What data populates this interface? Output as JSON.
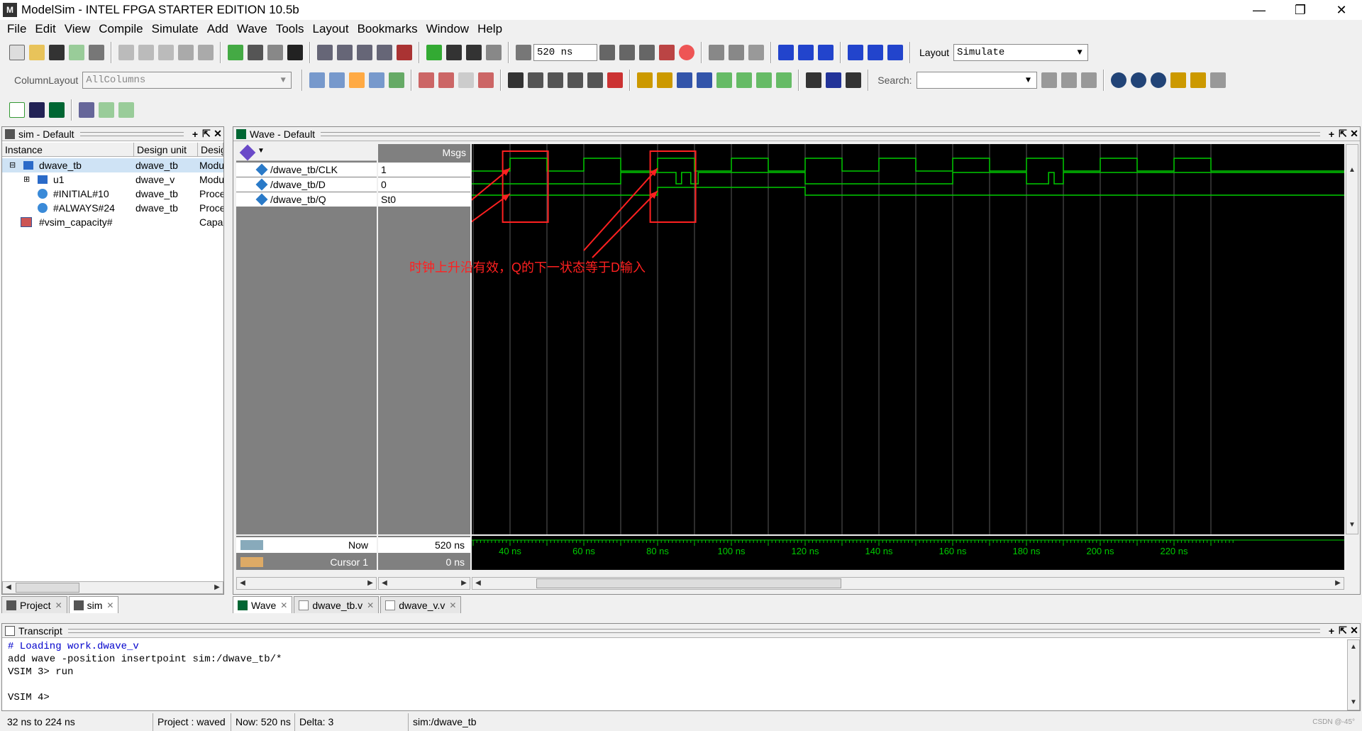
{
  "window": {
    "title": "ModelSim - INTEL FPGA STARTER EDITION 10.5b",
    "app_icon": "M"
  },
  "menu": [
    "File",
    "Edit",
    "View",
    "Compile",
    "Simulate",
    "Add",
    "Wave",
    "Tools",
    "Layout",
    "Bookmarks",
    "Window",
    "Help"
  ],
  "toolbar": {
    "run_length": "520 ns",
    "layout_label": "Layout",
    "layout_value": "Simulate",
    "column_layout_label": "ColumnLayout",
    "column_layout_value": "AllColumns",
    "search_label": "Search:",
    "search_value": ""
  },
  "sim_panel": {
    "title": "sim - Default",
    "columns": [
      "Instance",
      "Design unit",
      "Design"
    ],
    "rows": [
      {
        "instance": "dwave_tb",
        "unit": "dwave_tb",
        "design": "Modul"
      },
      {
        "instance": "u1",
        "unit": "dwave_v",
        "design": "Modul"
      },
      {
        "instance": "#INITIAL#10",
        "unit": "dwave_tb",
        "design": "Proce"
      },
      {
        "instance": "#ALWAYS#24",
        "unit": "dwave_tb",
        "design": "Proce"
      },
      {
        "instance": "#vsim_capacity#",
        "unit": "",
        "design": "Capac"
      }
    ],
    "tabs": [
      "Project",
      "sim"
    ]
  },
  "wave_panel": {
    "title": "Wave - Default",
    "msgs_header": "Msgs",
    "signals": [
      {
        "name": "/dwave_tb/CLK",
        "value": "1"
      },
      {
        "name": "/dwave_tb/D",
        "value": "0"
      },
      {
        "name": "/dwave_tb/Q",
        "value": "St0"
      }
    ],
    "now_label": "Now",
    "now_value": "520 ns",
    "cursor_label": "Cursor 1",
    "cursor_value": "0 ns",
    "time_ticks": [
      "40 ns",
      "60 ns",
      "80 ns",
      "100 ns",
      "120 ns",
      "140 ns",
      "160 ns",
      "180 ns",
      "200 ns",
      "220 ns"
    ],
    "annotation": "时钟上升沿有效，Q的下一状态等于D输入",
    "tabs": [
      "Wave",
      "dwave_tb.v",
      "dwave_v.v"
    ],
    "colors": {
      "wave": "#00cc00",
      "grid": "#5a5a5a",
      "annot": "#ff2020",
      "bg": "#000000"
    }
  },
  "transcript": {
    "title": "Transcript",
    "lines": [
      "# Loading work.dwave_v",
      "add wave -position insertpoint sim:/dwave_tb/*",
      "VSIM 3> run",
      "",
      "VSIM 4>"
    ]
  },
  "statusbar": {
    "range": "32 ns to 224 ns",
    "project": "Project : waved",
    "now": "Now: 520 ns",
    "delta": "Delta: 3",
    "context": "sim:/dwave_tb",
    "watermark": "CSDN @-45°"
  }
}
